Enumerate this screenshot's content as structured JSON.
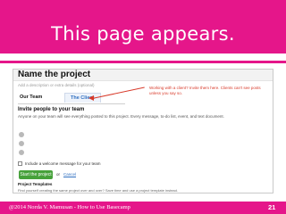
{
  "slide": {
    "title": "This page appears.",
    "footer": "@2014 Norda V. Mamusan - How to Use Basecamp",
    "page_number": "21",
    "accent_color": "#e5168a"
  },
  "screenshot": {
    "heading": "Name the project",
    "description_placeholder": "Add a description or extra details (optional)",
    "tabs": [
      "Our Team",
      "The Client"
    ],
    "callout": "Working with a client? Invite them here. Clients can't see posts unless you say so.",
    "invite_heading": "Invite people to your team",
    "invite_text": "Anyone on your team will see everything posted to this project. Every message, to-do list, event, and text document.",
    "person_icons": [
      "person-icon",
      "person-icon",
      "person-icon"
    ],
    "welcome_label": "Include a welcome message for your team",
    "start_button": "Start the project",
    "or_text": "or",
    "cancel_link": "Cancel",
    "templates_heading": "Project Templates",
    "templates_text": "Find yourself creating the same project over and over? Save time and use a project template instead."
  }
}
